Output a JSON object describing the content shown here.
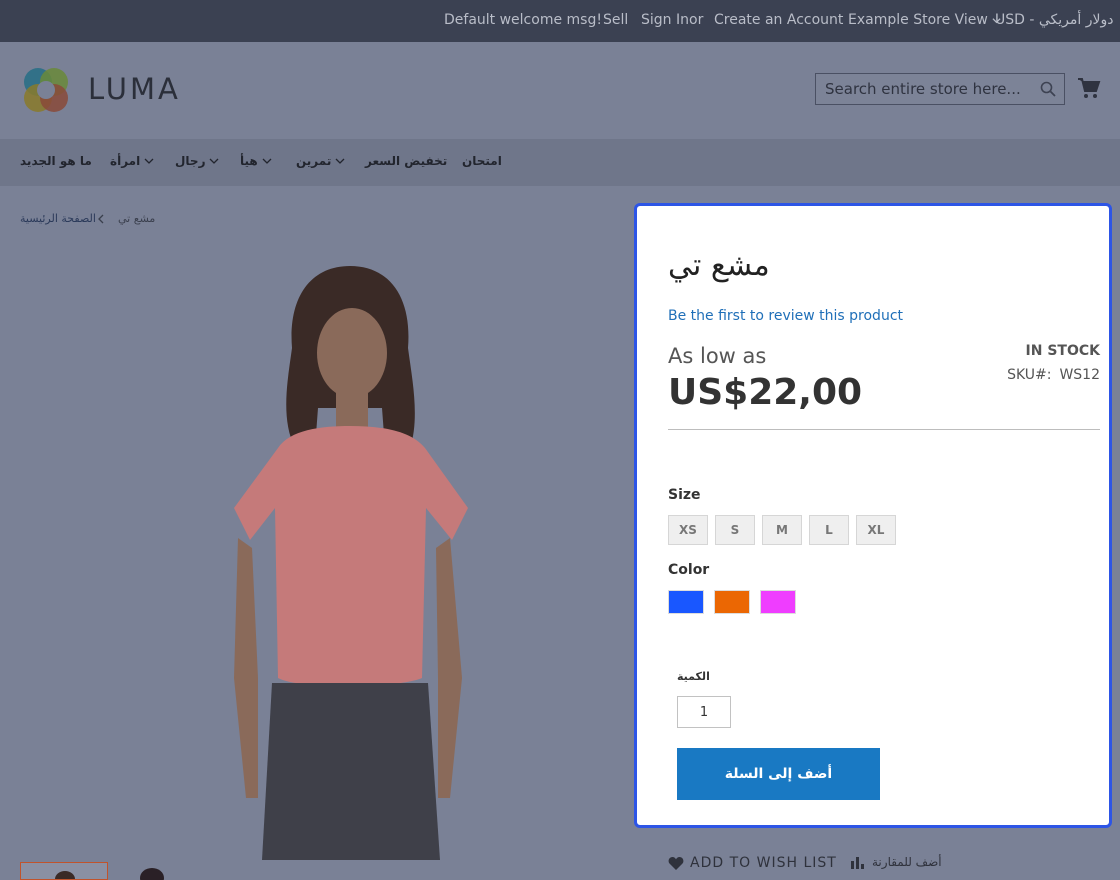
{
  "topbar": {
    "welcome": "Default welcome msg!",
    "sell": "Sell",
    "sign_in": "Sign In",
    "or": "or",
    "create_account": "Create an Account",
    "store_view": "Example Store View",
    "currency": "USD - دولار أمريكي"
  },
  "header": {
    "logo_text": "LUMA",
    "search_placeholder": "Search entire store here..."
  },
  "nav": {
    "items": [
      "ما هو الجديد",
      "امرأة",
      "رجال",
      "هيأ",
      "تمرين",
      "تخفيض السعر",
      "امتحان"
    ]
  },
  "breadcrumb": {
    "home": "الصفحة الرئيسية",
    "current": "مشع تي"
  },
  "product": {
    "title": "مشع تي",
    "review_link": "Be the first to review this product",
    "as_low_as": "As low as",
    "price": "US$22,00",
    "stock": "IN STOCK",
    "sku_label": "SKU#:",
    "sku": "WS12",
    "size_label": "Size",
    "sizes": [
      "XS",
      "S",
      "M",
      "L",
      "XL"
    ],
    "color_label": "Color",
    "colors": [
      "#1957ff",
      "#eb6703",
      "#ef3dff"
    ],
    "qty_label": "الكمية",
    "qty_value": "1",
    "add_to_cart": "أضف إلى السلة",
    "wish_list": "ADD TO WISH LIST",
    "compare": "أضف للمقارنة"
  }
}
